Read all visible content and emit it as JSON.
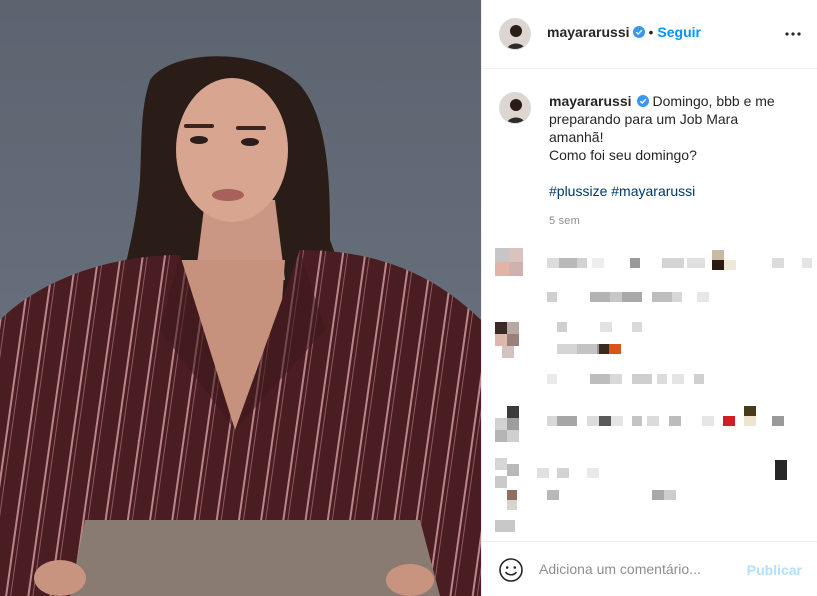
{
  "post": {
    "username": "mayararussi",
    "follow_label": "Seguir",
    "separator": "•",
    "caption_lines": [
      "Domingo, bbb e me",
      "preparando para um Job Mara",
      "amanhã!",
      "Como foi seu domingo?"
    ],
    "hashtags": "#plussize #mayararussi",
    "time_ago": "5 sem"
  },
  "comment_box": {
    "placeholder": "Adiciona um comentário...",
    "publish_label": "Publicar"
  },
  "colors": {
    "accent": "#0095f6",
    "publish_disabled": "#b2dffc",
    "hashtag": "#00376b",
    "verified": "#3897f0",
    "muted": "#8e8e8e"
  },
  "icons": {
    "verified": "verified-badge-icon",
    "more": "more-options-icon",
    "emoji": "emoji-icon"
  }
}
